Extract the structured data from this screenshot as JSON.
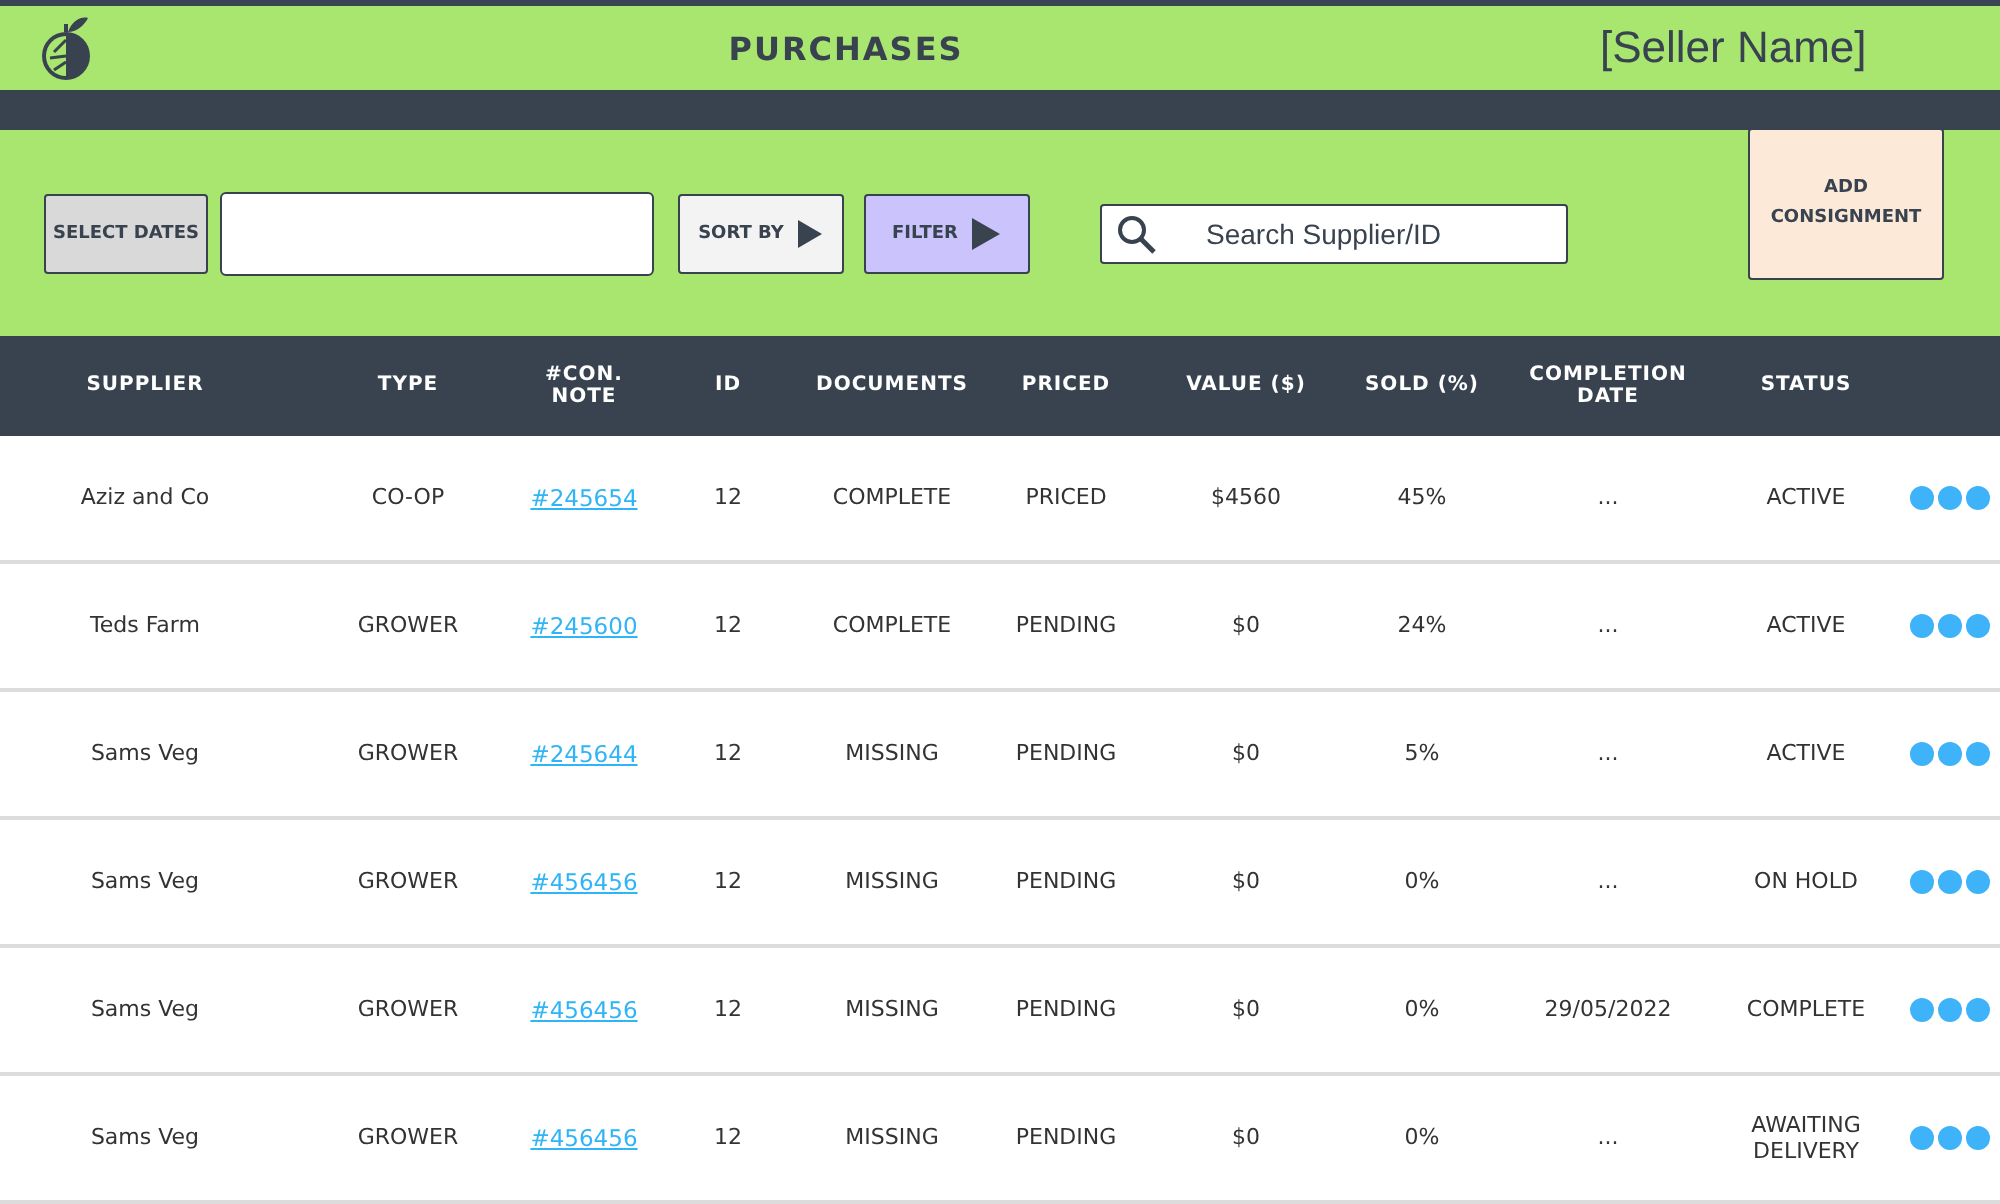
{
  "header": {
    "title": "PURCHASES",
    "seller": "[Seller Name]"
  },
  "toolbar": {
    "select_dates": "SELECT DATES",
    "sort_by": "SORT BY",
    "filter": "FILTER",
    "search": {
      "placeholder": "Search Supplier/ID"
    },
    "add": "ADD CONSIGNMENT"
  },
  "table": {
    "columns": [
      "SUPPLIER",
      "TYPE",
      "#CON. NOTE",
      "ID",
      "DOCUMENTS",
      "PRICED",
      "VALUE ($)",
      "SOLD (%)",
      "COMPLETION DATE",
      "STATUS"
    ],
    "rows": [
      {
        "supplier": "Aziz and Co",
        "type": "CO-OP",
        "con_note": "#245654",
        "id": "12",
        "documents": "COMPLETE",
        "priced": "PRICED",
        "value": "$4560",
        "sold": "45%",
        "completion_date": "...",
        "status": "ACTIVE"
      },
      {
        "supplier": "Teds Farm",
        "type": "GROWER",
        "con_note": "#245600",
        "id": "12",
        "documents": "COMPLETE",
        "priced": "PENDING",
        "value": "$0",
        "sold": "24%",
        "completion_date": "...",
        "status": "ACTIVE"
      },
      {
        "supplier": "Sams Veg",
        "type": "GROWER",
        "con_note": "#245644",
        "id": "12",
        "documents": "MISSING",
        "priced": "PENDING",
        "value": "$0",
        "sold": "5%",
        "completion_date": "...",
        "status": "ACTIVE"
      },
      {
        "supplier": "Sams Veg",
        "type": "GROWER",
        "con_note": "#456456",
        "id": "12",
        "documents": "MISSING",
        "priced": "PENDING",
        "value": "$0",
        "sold": "0%",
        "completion_date": "...",
        "status": "ON HOLD"
      },
      {
        "supplier": "Sams Veg",
        "type": "GROWER",
        "con_note": "#456456",
        "id": "12",
        "documents": "MISSING",
        "priced": "PENDING",
        "value": "$0",
        "sold": "0%",
        "completion_date": "29/05/2022",
        "status": "COMPLETE"
      },
      {
        "supplier": "Sams Veg",
        "type": "GROWER",
        "con_note": "#456456",
        "id": "12",
        "documents": "MISSING",
        "priced": "PENDING",
        "value": "$0",
        "sold": "0%",
        "completion_date": "...",
        "status": "AWAITING DELIVERY"
      }
    ]
  }
}
